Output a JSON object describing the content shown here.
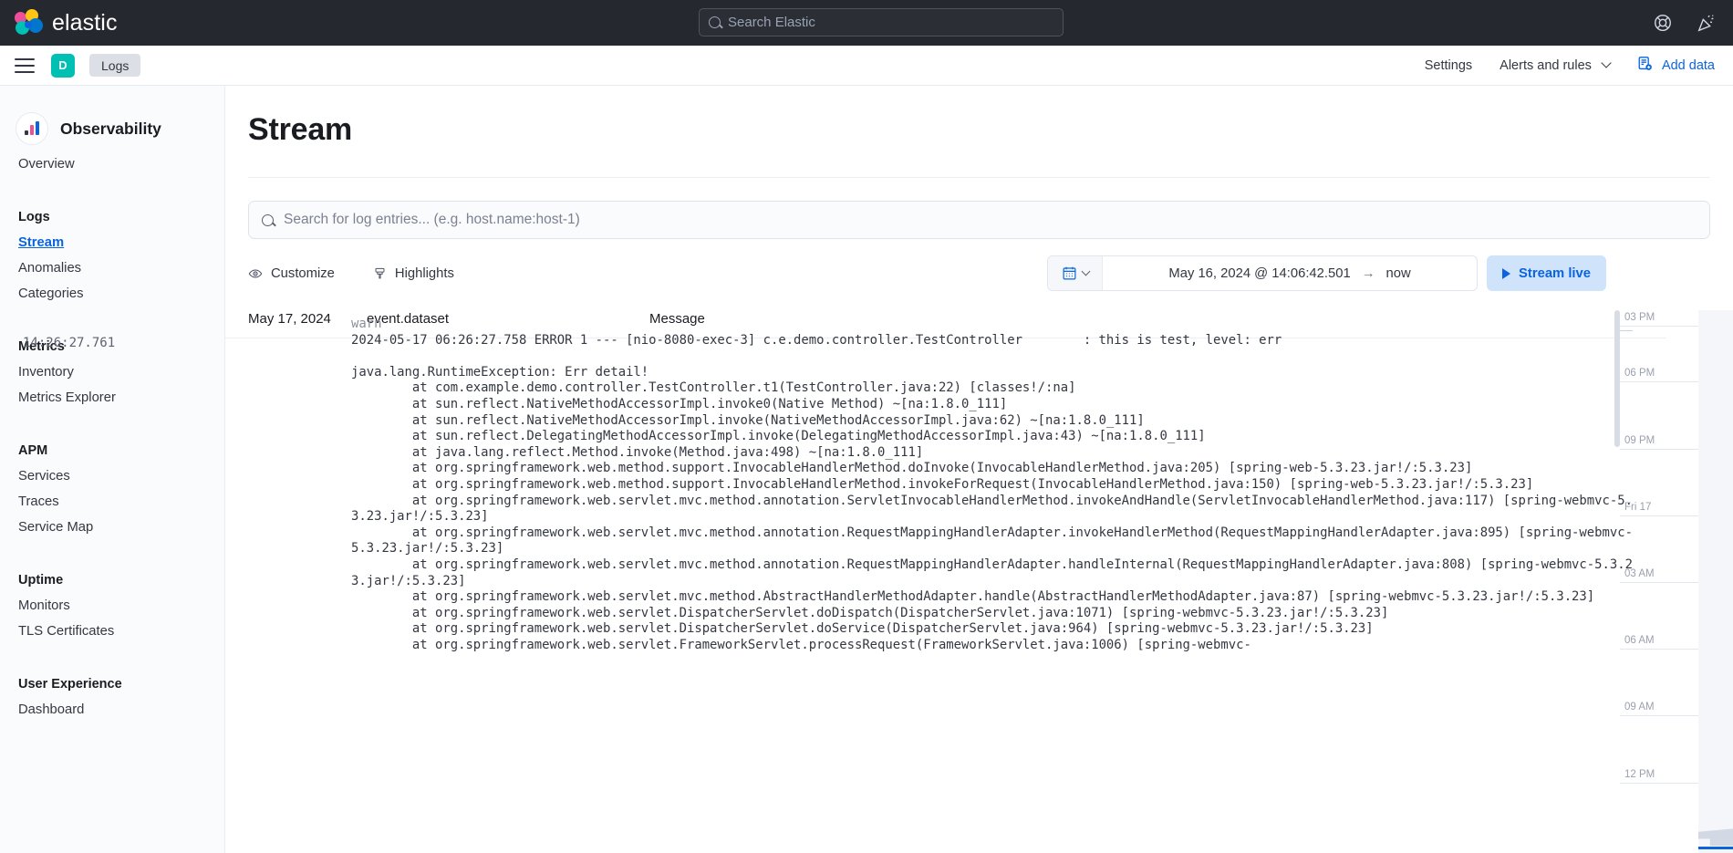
{
  "header": {
    "brand": "elastic",
    "search_placeholder": "Search Elastic",
    "help_icon": "lifebuoy-icon",
    "news_icon": "party-popper-icon"
  },
  "subheader": {
    "menu_icon": "hamburger-menu-icon",
    "space_initial": "D",
    "app_chip": "Logs",
    "settings": "Settings",
    "alerts_and_rules": "Alerts and rules",
    "add_data": "Add data",
    "add_data_icon": "add-data-icon",
    "accent": "#0b64dd"
  },
  "sidebar": {
    "title": "Observability",
    "title_icon": "bar-chart-icon",
    "overview": "Overview",
    "groups": [
      {
        "title": "Logs",
        "items": [
          "Stream",
          "Anomalies",
          "Categories"
        ],
        "active": "Stream"
      },
      {
        "title": "Metrics",
        "items": [
          "Inventory",
          "Metrics Explorer"
        ],
        "active": ""
      },
      {
        "title": "APM",
        "items": [
          "Services",
          "Traces",
          "Service Map"
        ],
        "active": ""
      },
      {
        "title": "Uptime",
        "items": [
          "Monitors",
          "TLS Certificates"
        ],
        "active": ""
      },
      {
        "title": "User Experience",
        "items": [
          "Dashboard"
        ],
        "active": ""
      }
    ]
  },
  "main": {
    "page_title": "Stream",
    "search_placeholder": "Search for log entries... (e.g. host.name:host-1)",
    "search_icon": "search-icon",
    "customize": "Customize",
    "customize_icon": "eye-icon",
    "highlights": "Highlights",
    "highlights_icon": "highlighter-icon",
    "calendar_icon": "calendar-icon",
    "date_start": "May 16, 2024 @ 14:06:42.501",
    "date_arrow": "→",
    "date_end": "now",
    "stream_live": "Stream live",
    "stream_live_icon": "play-icon"
  },
  "table": {
    "col_date": "May 17, 2024",
    "col_dataset": "event.dataset",
    "col_message": "Message",
    "partial_top_line": "warn",
    "rows": [
      {
        "timestamp": "14:26:27.761",
        "dataset": "",
        "message": "2024-05-17 06:26:27.758 ERROR 1 --- [nio-8080-exec-3] c.e.demo.controller.TestController        : this is test, level: err\n\njava.lang.RuntimeException: Err detail!\n\tat com.example.demo.controller.TestController.t1(TestController.java:22) [classes!/:na]\n\tat sun.reflect.NativeMethodAccessorImpl.invoke0(Native Method) ~[na:1.8.0_111]\n\tat sun.reflect.NativeMethodAccessorImpl.invoke(NativeMethodAccessorImpl.java:62) ~[na:1.8.0_111]\n\tat sun.reflect.DelegatingMethodAccessorImpl.invoke(DelegatingMethodAccessorImpl.java:43) ~[na:1.8.0_111]\n\tat java.lang.reflect.Method.invoke(Method.java:498) ~[na:1.8.0_111]\n\tat org.springframework.web.method.support.InvocableHandlerMethod.doInvoke(InvocableHandlerMethod.java:205) [spring-web-5.3.23.jar!/:5.3.23]\n\tat org.springframework.web.method.support.InvocableHandlerMethod.invokeForRequest(InvocableHandlerMethod.java:150) [spring-web-5.3.23.jar!/:5.3.23]\n\tat org.springframework.web.servlet.mvc.method.annotation.ServletInvocableHandlerMethod.invokeAndHandle(ServletInvocableHandlerMethod.java:117) [spring-webmvc-5.3.23.jar!/:5.3.23]\n\tat org.springframework.web.servlet.mvc.method.annotation.RequestMappingHandlerAdapter.invokeHandlerMethod(RequestMappingHandlerAdapter.java:895) [spring-webmvc-5.3.23.jar!/:5.3.23]\n\tat org.springframework.web.servlet.mvc.method.annotation.RequestMappingHandlerAdapter.handleInternal(RequestMappingHandlerAdapter.java:808) [spring-webmvc-5.3.23.jar!/:5.3.23]\n\tat org.springframework.web.servlet.mvc.method.AbstractHandlerMethodAdapter.handle(AbstractHandlerMethodAdapter.java:87) [spring-webmvc-5.3.23.jar!/:5.3.23]\n\tat org.springframework.web.servlet.DispatcherServlet.doDispatch(DispatcherServlet.java:1071) [spring-webmvc-5.3.23.jar!/:5.3.23]\n\tat org.springframework.web.servlet.DispatcherServlet.doService(DispatcherServlet.java:964) [spring-webmvc-5.3.23.jar!/:5.3.23]\n\tat org.springframework.web.servlet.FrameworkServlet.processRequest(FrameworkServlet.java:1006) [spring-webmvc-"
      }
    ]
  },
  "minimap": {
    "ticks": [
      "03 PM",
      "06 PM",
      "09 PM",
      "Fri 17",
      "03 AM",
      "06 AM",
      "09 AM",
      "12 PM"
    ],
    "highlight_color": "#0b64dd"
  }
}
